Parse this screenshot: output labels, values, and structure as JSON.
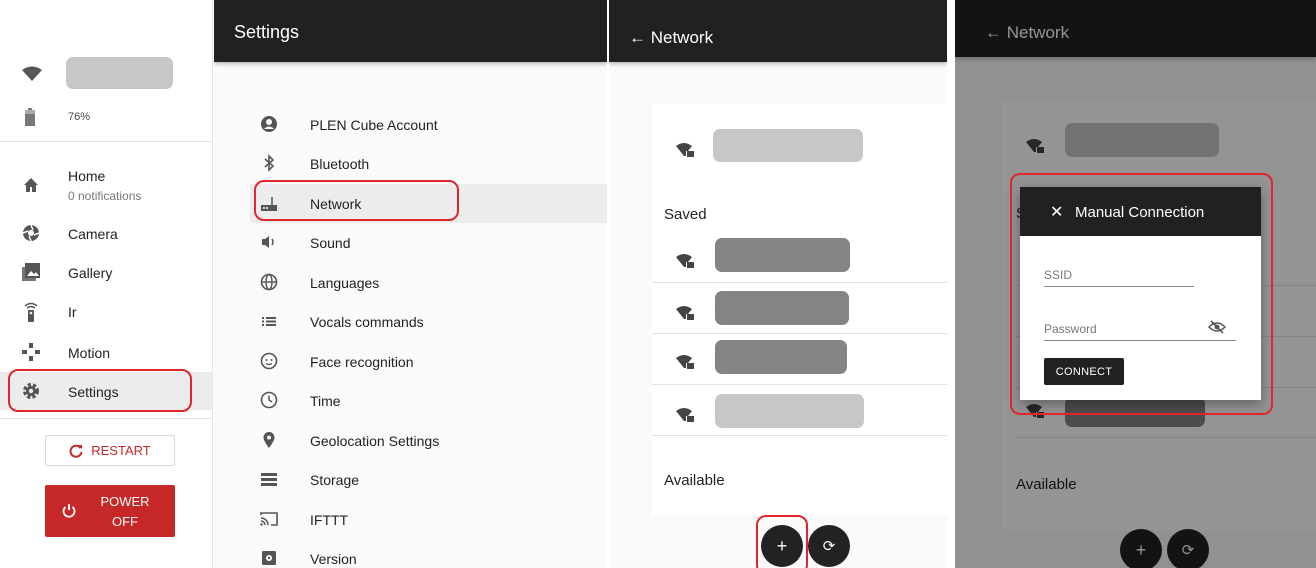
{
  "drawer": {
    "battery_level": "76%",
    "items": [
      {
        "label": "Home",
        "sub": "0 notifications",
        "icon": "home-icon"
      },
      {
        "label": "Camera",
        "icon": "camera-icon"
      },
      {
        "label": "Gallery",
        "icon": "gallery-icon"
      },
      {
        "label": "Ir",
        "icon": "ir-remote-icon"
      },
      {
        "label": "Motion",
        "icon": "motion-icon"
      },
      {
        "label": "Settings",
        "icon": "gear-icon"
      }
    ],
    "restart_label": "RESTART",
    "power_line1": "POWER",
    "power_line2": "OFF"
  },
  "settings": {
    "title": "Settings",
    "items": [
      {
        "label": "PLEN Cube Account",
        "icon": "account-icon"
      },
      {
        "label": "Bluetooth",
        "icon": "bluetooth-icon"
      },
      {
        "label": "Network",
        "icon": "router-icon"
      },
      {
        "label": "Sound",
        "icon": "speaker-icon"
      },
      {
        "label": "Languages",
        "icon": "globe-icon"
      },
      {
        "label": "Vocals commands",
        "icon": "list-icon"
      },
      {
        "label": "Face recognition",
        "icon": "face-icon"
      },
      {
        "label": "Time",
        "icon": "clock-icon"
      },
      {
        "label": "Geolocation Settings",
        "icon": "location-pin-icon"
      },
      {
        "label": "Storage",
        "icon": "storage-icon"
      },
      {
        "label": "IFTTT",
        "icon": "cast-icon"
      },
      {
        "label": "Version",
        "icon": "version-icon"
      }
    ]
  },
  "network": {
    "back_title": "← Network",
    "saved_label": "Saved",
    "available_label": "Available",
    "add_label": "+",
    "refresh_label": "⟳"
  },
  "dialog": {
    "back_title": "← Network",
    "title": "Manual Connection",
    "close_label": "✕",
    "ssid_placeholder": "SSID",
    "password_placeholder": "Password",
    "connect_label": "CONNECT",
    "bg_saved_initial": "S",
    "bg_available_label": "Available",
    "add_label": "+",
    "refresh_label": "⟳"
  },
  "colors": {
    "accent_red": "#c62828",
    "highlight_red": "#e0252c",
    "appbar": "#212121"
  }
}
